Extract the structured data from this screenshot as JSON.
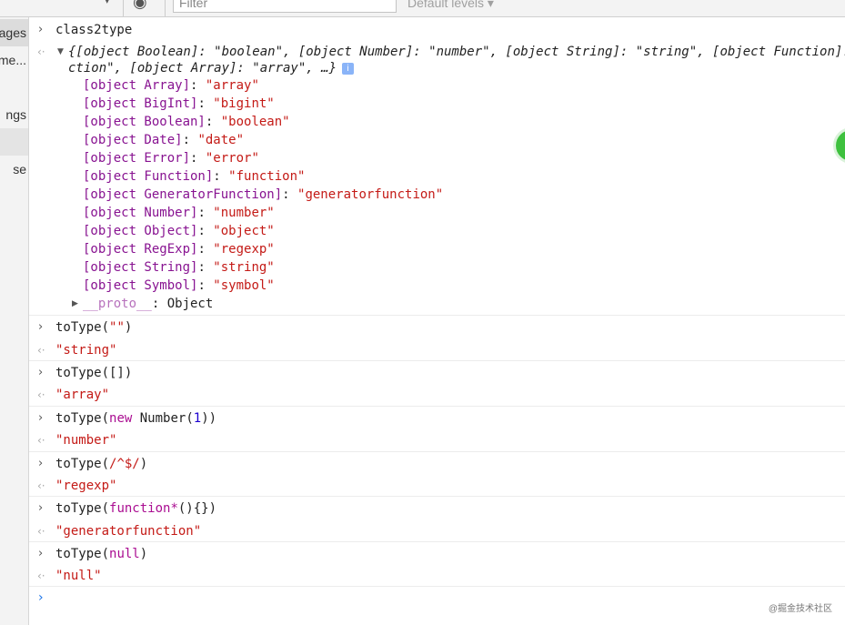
{
  "toolbar": {
    "filter_placeholder": "Filter",
    "levels_label": "Default levels ▾",
    "dropdown_arrow": "▾",
    "eye_glyph": "◉"
  },
  "sidebar": {
    "items": [
      "ages",
      "me...",
      "ngs",
      "",
      "se"
    ]
  },
  "console": {
    "entries": [
      {
        "input": "class2type",
        "summary_line1": "{[object Boolean]: \"boolean\", [object Number]: \"number\", [object String]: \"string\", [object Function]: \"",
        "summary_line2": "ction\", [object Array]: \"array\", …}",
        "info": "i",
        "properties": [
          {
            "key": "[object Array]",
            "value": "\"array\""
          },
          {
            "key": "[object BigInt]",
            "value": "\"bigint\""
          },
          {
            "key": "[object Boolean]",
            "value": "\"boolean\""
          },
          {
            "key": "[object Date]",
            "value": "\"date\""
          },
          {
            "key": "[object Error]",
            "value": "\"error\""
          },
          {
            "key": "[object Function]",
            "value": "\"function\""
          },
          {
            "key": "[object GeneratorFunction]",
            "value": "\"generatorfunction\""
          },
          {
            "key": "[object Number]",
            "value": "\"number\""
          },
          {
            "key": "[object Object]",
            "value": "\"object\""
          },
          {
            "key": "[object RegExp]",
            "value": "\"regexp\""
          },
          {
            "key": "[object String]",
            "value": "\"string\""
          },
          {
            "key": "[object Symbol]",
            "value": "\"symbol\""
          }
        ],
        "proto_key": "__proto__",
        "proto_value": "Object"
      },
      {
        "input_fn": "toType(",
        "input_arg": "\"\"",
        "input_end": ")",
        "output": "\"string\""
      },
      {
        "input": "toType([])",
        "output": "\"array\""
      },
      {
        "input_fn": "toType(",
        "input_kw": "new",
        "input_mid": " Number(",
        "input_num": "1",
        "input_end": "))",
        "output": "\"number\""
      },
      {
        "input_fn": "toType(",
        "input_arg": "/^$/",
        "input_end": ")",
        "output": "\"regexp\""
      },
      {
        "input_fn": "toType(",
        "input_kw": "function*",
        "input_end": "(){})",
        "output": "\"generatorfunction\""
      },
      {
        "input_fn": "toType(",
        "input_kw": "null",
        "input_end": ")",
        "output": "\"null\""
      }
    ],
    "prompt_glyph": "›",
    "input_glyph": "›",
    "output_glyph": "‹·"
  },
  "watermark": "@掘金技术社区"
}
